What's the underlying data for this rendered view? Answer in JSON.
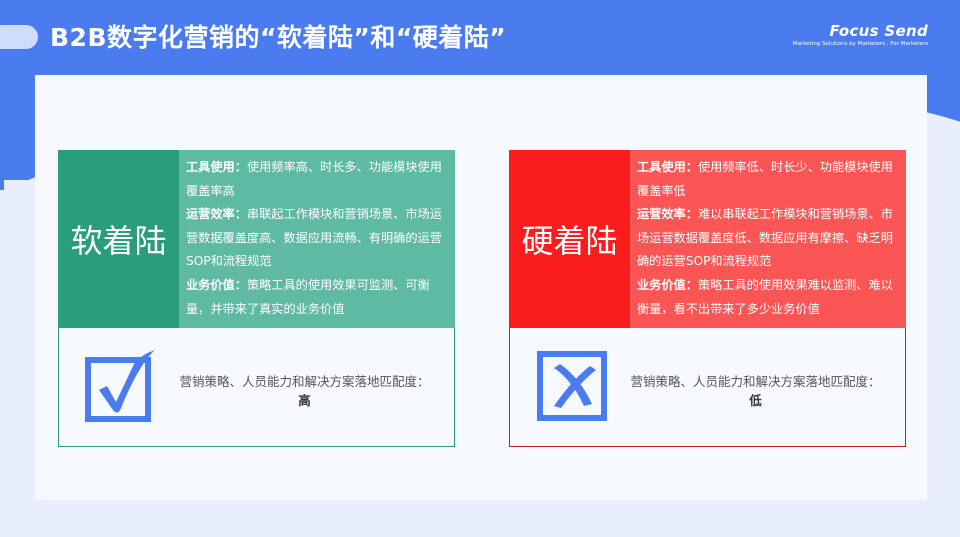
{
  "header": {
    "title": "B2B数字化营销的“软着陆”和“硬着陆”",
    "logo_brand": "Focus Send",
    "logo_tagline": "Marketing Solutions by Marketers , For Marketers"
  },
  "soft": {
    "label": "软着陆",
    "items": [
      {
        "key": "工具使用：",
        "text": "使用频率高、时长多、功能模块使用覆盖率高"
      },
      {
        "key": "运营效率：",
        "text": "串联起工作模块和营销场景、市场运营数据覆盖度高、数据应用流畅、有明确的运营SOP和流程规范"
      },
      {
        "key": "业务价值：",
        "text": "策略工具的使用效果可监测、可衡量，并带来了真实的业务价值"
      }
    ],
    "match_label": "营销策略、人员能力和解决方案落地匹配度：",
    "match_level": "高",
    "icon": "checkbox-checked-icon",
    "colors": {
      "label_bg": "#2a9d7b",
      "desc_bg": "#5ebaa3",
      "icon": "#4a7cf0"
    }
  },
  "hard": {
    "label": "硬着陆",
    "items": [
      {
        "key": "工具使用：",
        "text": "使用频率低、时长少、功能模块使用覆盖率低"
      },
      {
        "key": "运营效率：",
        "text": "难以串联起工作模块和营销场景、市场运营数据覆盖度低、数据应用有摩擦、缺乏明确的运营SOP和流程规范"
      },
      {
        "key": "业务价值：",
        "text": "策略工具的使用效果难以监测、难以衡量，看不出带来了多少业务价值"
      }
    ],
    "match_label": "营销策略、人员能力和解决方案落地匹配度：",
    "match_level": "低",
    "icon": "checkbox-crossed-icon",
    "colors": {
      "label_bg": "#fb1d1d",
      "desc_bg": "#fb5555",
      "icon": "#4a7cf0"
    }
  },
  "theme": {
    "primary": "#4a7cf0",
    "panel_bg": "#f6f9fe"
  }
}
